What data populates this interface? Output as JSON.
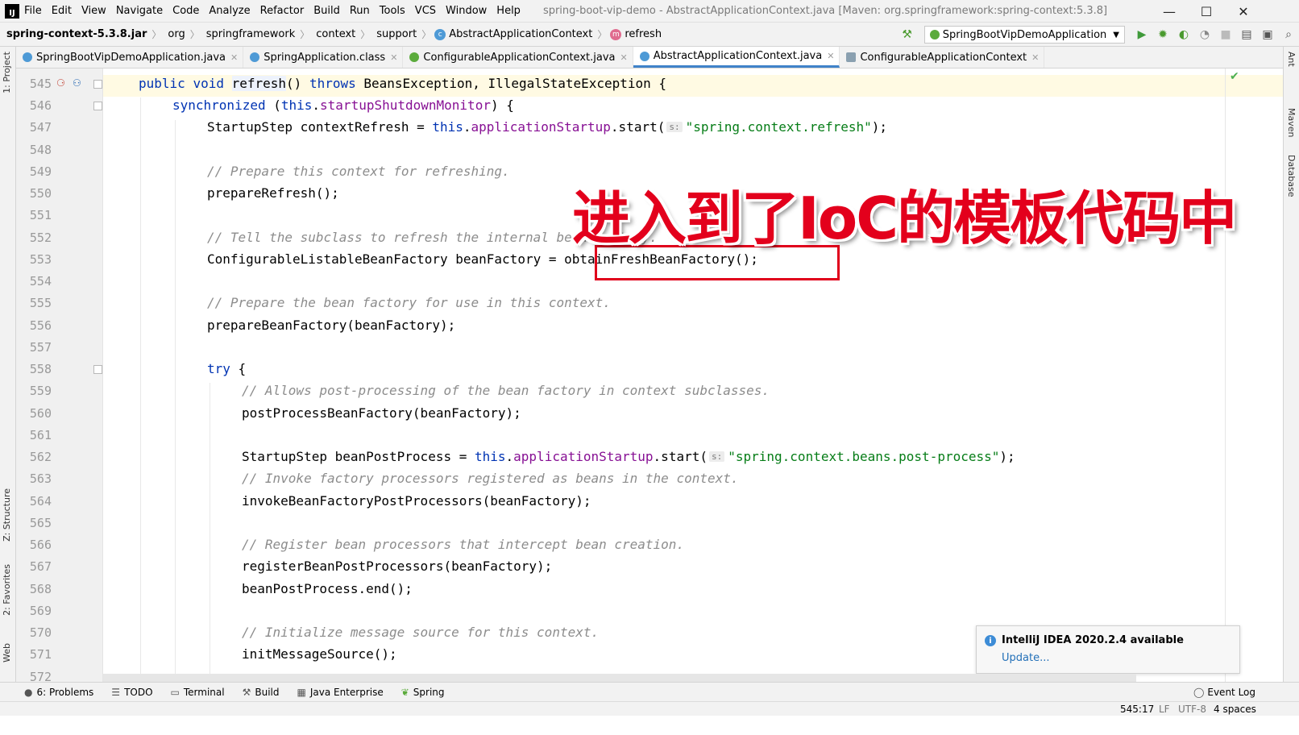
{
  "menubar": {
    "logo": "IJ",
    "items": [
      "File",
      "Edit",
      "View",
      "Navigate",
      "Code",
      "Analyze",
      "Refactor",
      "Build",
      "Run",
      "Tools",
      "VCS",
      "Window",
      "Help"
    ],
    "title": "spring-boot-vip-demo - AbstractApplicationContext.java [Maven: org.springframework:spring-context:5.3.8]",
    "controls": {
      "minimize": "—",
      "maximize": "☐",
      "close": "✕"
    }
  },
  "breadcrumbs": [
    "spring-context-5.3.8.jar",
    "org",
    "springframework",
    "context",
    "support",
    "AbstractApplicationContext",
    "refresh"
  ],
  "run_config": "SpringBootVipDemoApplication",
  "tabs": [
    {
      "label": "SpringBootVipDemoApplication.java",
      "icon_color": "#4e9ad6",
      "active": false
    },
    {
      "label": "SpringApplication.class",
      "icon_color": "#4e9ad6",
      "active": false
    },
    {
      "label": "ConfigurableApplicationContext.java",
      "icon_color": "#5bab3c",
      "active": false
    },
    {
      "label": "AbstractApplicationContext.java",
      "icon_color": "#4e9ad6",
      "active": true
    },
    {
      "label": "ConfigurableApplicationContext",
      "icon_color": "#8aa0b0",
      "active": false
    }
  ],
  "left_tools": {
    "project": "1: Project",
    "structure": "Z: Structure",
    "favorites": "2: Favorites",
    "web": "Web"
  },
  "right_tools": {
    "ant": "Ant",
    "maven": "Maven",
    "database": "Database"
  },
  "line_numbers": [
    "545",
    "546",
    "547",
    "548",
    "549",
    "550",
    "551",
    "552",
    "553",
    "554",
    "555",
    "556",
    "557",
    "558",
    "559",
    "560",
    "561",
    "562",
    "563",
    "564",
    "565",
    "566",
    "567",
    "568",
    "569",
    "570",
    "571",
    "572"
  ],
  "code": {
    "l545": {
      "k1": "public",
      "k2": "void",
      "m": "refresh",
      "rest1": "() ",
      "k3": "throws",
      "rest2": " BeansException, IllegalStateException {"
    },
    "l546": {
      "k1": "synchronized",
      "rest1": " (",
      "k2": "this",
      "rest2": ".",
      "f": "startupShutdownMonitor",
      "rest3": ") {"
    },
    "l547": {
      "a": "StartupStep contextRefresh = ",
      "k": "this",
      "b": ".",
      "f": "applicationStartup",
      "c": ".start(",
      "hint": "s:",
      "s": "\"spring.context.refresh\"",
      "d": ");"
    },
    "l549": "// Prepare this context for refreshing.",
    "l550": "prepareRefresh();",
    "l552": "// Tell the subclass to refresh the internal bean factory.",
    "l553": "ConfigurableListableBeanFactory beanFactory = obtainFreshBeanFactory();",
    "l555": "// Prepare the bean factory for use in this context.",
    "l556": "prepareBeanFactory(beanFactory);",
    "l558": {
      "k": "try",
      "rest": " {"
    },
    "l559": "// Allows post-processing of the bean factory in context subclasses.",
    "l560": "postProcessBeanFactory(beanFactory);",
    "l562": {
      "a": "StartupStep beanPostProcess = ",
      "k": "this",
      "b": ".",
      "f": "applicationStartup",
      "c": ".start(",
      "hint": "s:",
      "s": "\"spring.context.beans.post-process\"",
      "d": ");"
    },
    "l563": "// Invoke factory processors registered as beans in the context.",
    "l564": "invokeBeanFactoryPostProcessors(beanFactory);",
    "l566": "// Register bean processors that intercept bean creation.",
    "l567": "registerBeanPostProcessors(beanFactory);",
    "l568": "beanPostProcess.end();",
    "l570": "// Initialize message source for this context.",
    "l571": "initMessageSource();"
  },
  "overlay_caption": "进入到了IoC的模板代码中",
  "notification": {
    "title": "IntelliJ IDEA 2020.2.4 available",
    "link": "Update..."
  },
  "bottom_tools": [
    "6: Problems",
    "TODO",
    "Terminal",
    "Build",
    "Java Enterprise",
    "Spring"
  ],
  "event_log": "Event Log",
  "status": {
    "position": "545:17",
    "line_sep": "LF",
    "encoding": "UTF-8",
    "indent": "4 spaces"
  },
  "colors": {
    "keyword": "#0033b3",
    "field": "#871094",
    "string": "#067d17",
    "comment": "#8c8c8c",
    "annotation_red": "#e3001c",
    "active_tab": "#4083c9"
  }
}
